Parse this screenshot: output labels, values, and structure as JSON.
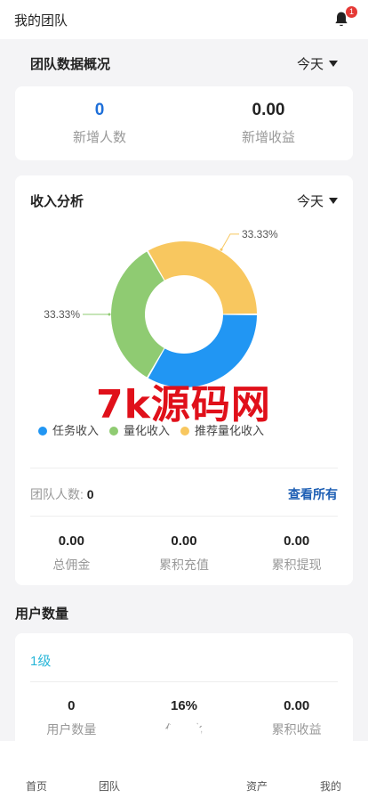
{
  "header": {
    "title": "我的团队",
    "notification_count": "1"
  },
  "team_overview": {
    "title": "团队数据概况",
    "period": "今天",
    "new_members_value": "0",
    "new_members_label": "新增人数",
    "new_income_value": "0.00",
    "new_income_label": "新增收益"
  },
  "income_analysis": {
    "title": "收入分析",
    "period": "今天",
    "legend": [
      "任务收入",
      "量化收入",
      "推荐量化收入"
    ],
    "team_count_label": "团队人数: ",
    "team_count_value": "0",
    "view_all": "查看所有",
    "stats": [
      {
        "value": "0.00",
        "label": "总佣金"
      },
      {
        "value": "0.00",
        "label": "累积充值"
      },
      {
        "value": "0.00",
        "label": "累积提现"
      }
    ]
  },
  "chart_data": {
    "type": "pie",
    "donut": true,
    "categories": [
      "任务收入",
      "量化收入",
      "推荐量化收入"
    ],
    "values": [
      33.33,
      33.33,
      33.33
    ],
    "data_labels": [
      "",
      "33.33%",
      "33.33%"
    ],
    "colors": [
      "#2196f3",
      "#8fcb72",
      "#f8c75f"
    ]
  },
  "users": {
    "title": "用户数量",
    "level": "1级",
    "stats": [
      {
        "value": "0",
        "label": "用户数量"
      },
      {
        "value": "16%",
        "label": "佣金比"
      },
      {
        "value": "0.00",
        "label": "累积收益"
      }
    ]
  },
  "watermark": "7k源码网",
  "tabbar": {
    "home": "首页",
    "team": "团队",
    "assets": "资产",
    "mine": "我的"
  }
}
